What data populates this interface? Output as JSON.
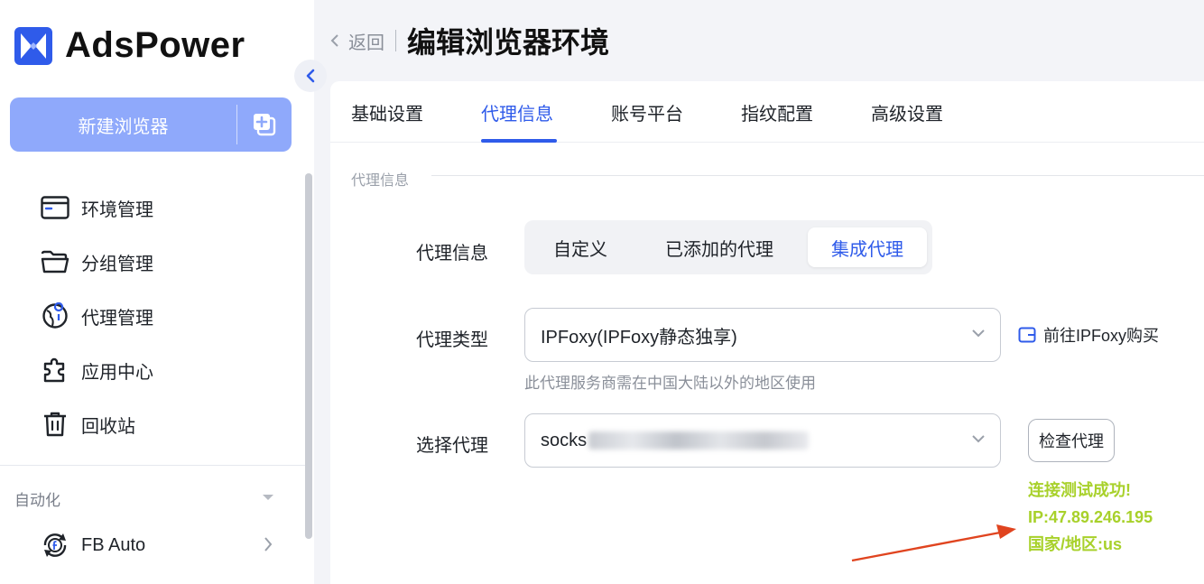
{
  "app": {
    "brand": "AdsPower"
  },
  "sidebar": {
    "new_browser_label": "新建浏览器",
    "nav": [
      {
        "label": "环境管理",
        "icon": "browser-window-icon"
      },
      {
        "label": "分组管理",
        "icon": "folder-icon"
      },
      {
        "label": "代理管理",
        "icon": "globe-pin-icon"
      },
      {
        "label": "应用中心",
        "icon": "puzzle-icon"
      },
      {
        "label": "回收站",
        "icon": "trash-icon"
      }
    ],
    "section_title": "自动化",
    "fb_auto": {
      "label": "FB Auto",
      "icon": "facebook-sync-icon"
    }
  },
  "header": {
    "back_label": "返回",
    "title": "编辑浏览器环境"
  },
  "tabs": [
    {
      "label": "基础设置",
      "active": false
    },
    {
      "label": "代理信息",
      "active": true
    },
    {
      "label": "账号平台",
      "active": false
    },
    {
      "label": "指纹配置",
      "active": false
    },
    {
      "label": "高级设置",
      "active": false
    }
  ],
  "form": {
    "section_label": "代理信息",
    "proxy_info": {
      "label": "代理信息",
      "options": [
        "自定义",
        "已添加的代理",
        "集成代理"
      ],
      "selected": "集成代理"
    },
    "proxy_type": {
      "label": "代理类型",
      "value": "IPFoxy(IPFoxy静态独享)",
      "hint": "此代理服务商需在中国大陆以外的地区使用",
      "buy_link": "前往IPFoxy购买"
    },
    "select_proxy": {
      "label": "选择代理",
      "value_prefix": "socks",
      "check_button": "检查代理"
    },
    "result": {
      "line1": "连接测试成功!",
      "line2": "IP:47.89.246.195",
      "line3": "国家/地区:us"
    }
  },
  "colors": {
    "accent": "#2f5bea",
    "success": "#a8d12b",
    "annotation_arrow": "#e0441f"
  }
}
